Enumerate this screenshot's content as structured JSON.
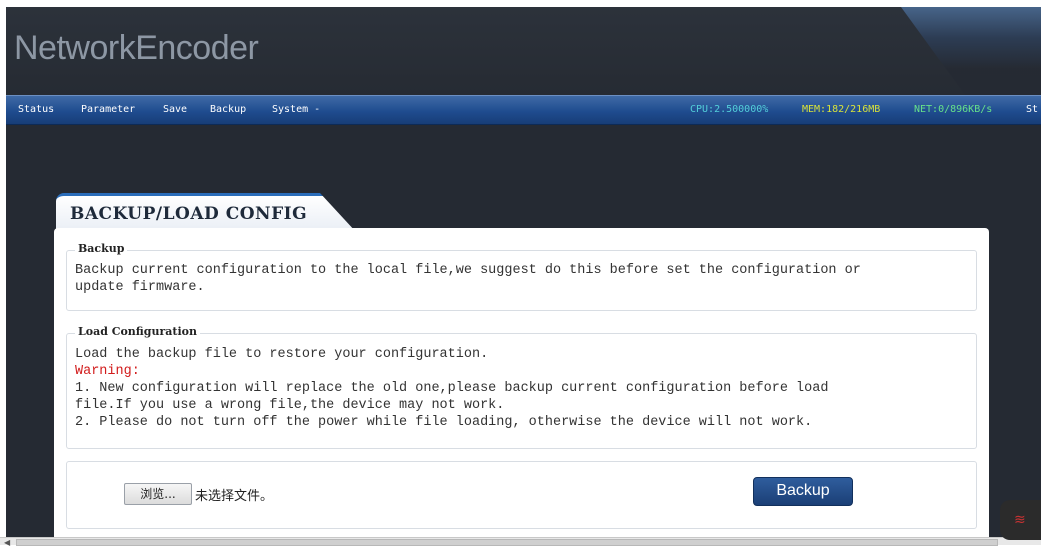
{
  "app": {
    "logo": "NetworkEncoder"
  },
  "nav": {
    "items": [
      {
        "label": "Status"
      },
      {
        "label": "Parameter"
      },
      {
        "label": "Save"
      },
      {
        "label": "Backup"
      },
      {
        "label": "System -"
      }
    ],
    "stats": {
      "cpu": "CPU:2.500000%",
      "mem": "MEM:182/216MB",
      "net": "NET:0/896KB/s",
      "overflow": "St"
    }
  },
  "panel": {
    "title": "BACKUP/LOAD CONFIG",
    "backup_section": {
      "legend": "Backup",
      "text": "Backup current configuration to the local file,we suggest do this before set the configuration or\nupdate firmware."
    },
    "load_section": {
      "legend": "Load Configuration",
      "line1": "Load the backup file to restore your configuration.",
      "warning": "Warning:",
      "line2": "1. New configuration will replace the old one,please backup current configuration before load\nfile.If you use a wrong file,the device may not work.",
      "line3": "2. Please do not turn off the power while file loading, otherwise the device will not work."
    },
    "file_input": {
      "browse_label": "浏览...",
      "status": "未选择文件。"
    },
    "backup_button": "Backup"
  },
  "colors": {
    "background": "#252a33",
    "navbar": "#1f4c8f",
    "cpu": "#53cfd9",
    "mem": "#d8e23a",
    "net": "#67e28a",
    "warning": "#d21c1c",
    "button": "#1b3f76"
  },
  "icons": {
    "wifi": "wifi-icon",
    "scroll_left": "arrow-left-icon"
  }
}
